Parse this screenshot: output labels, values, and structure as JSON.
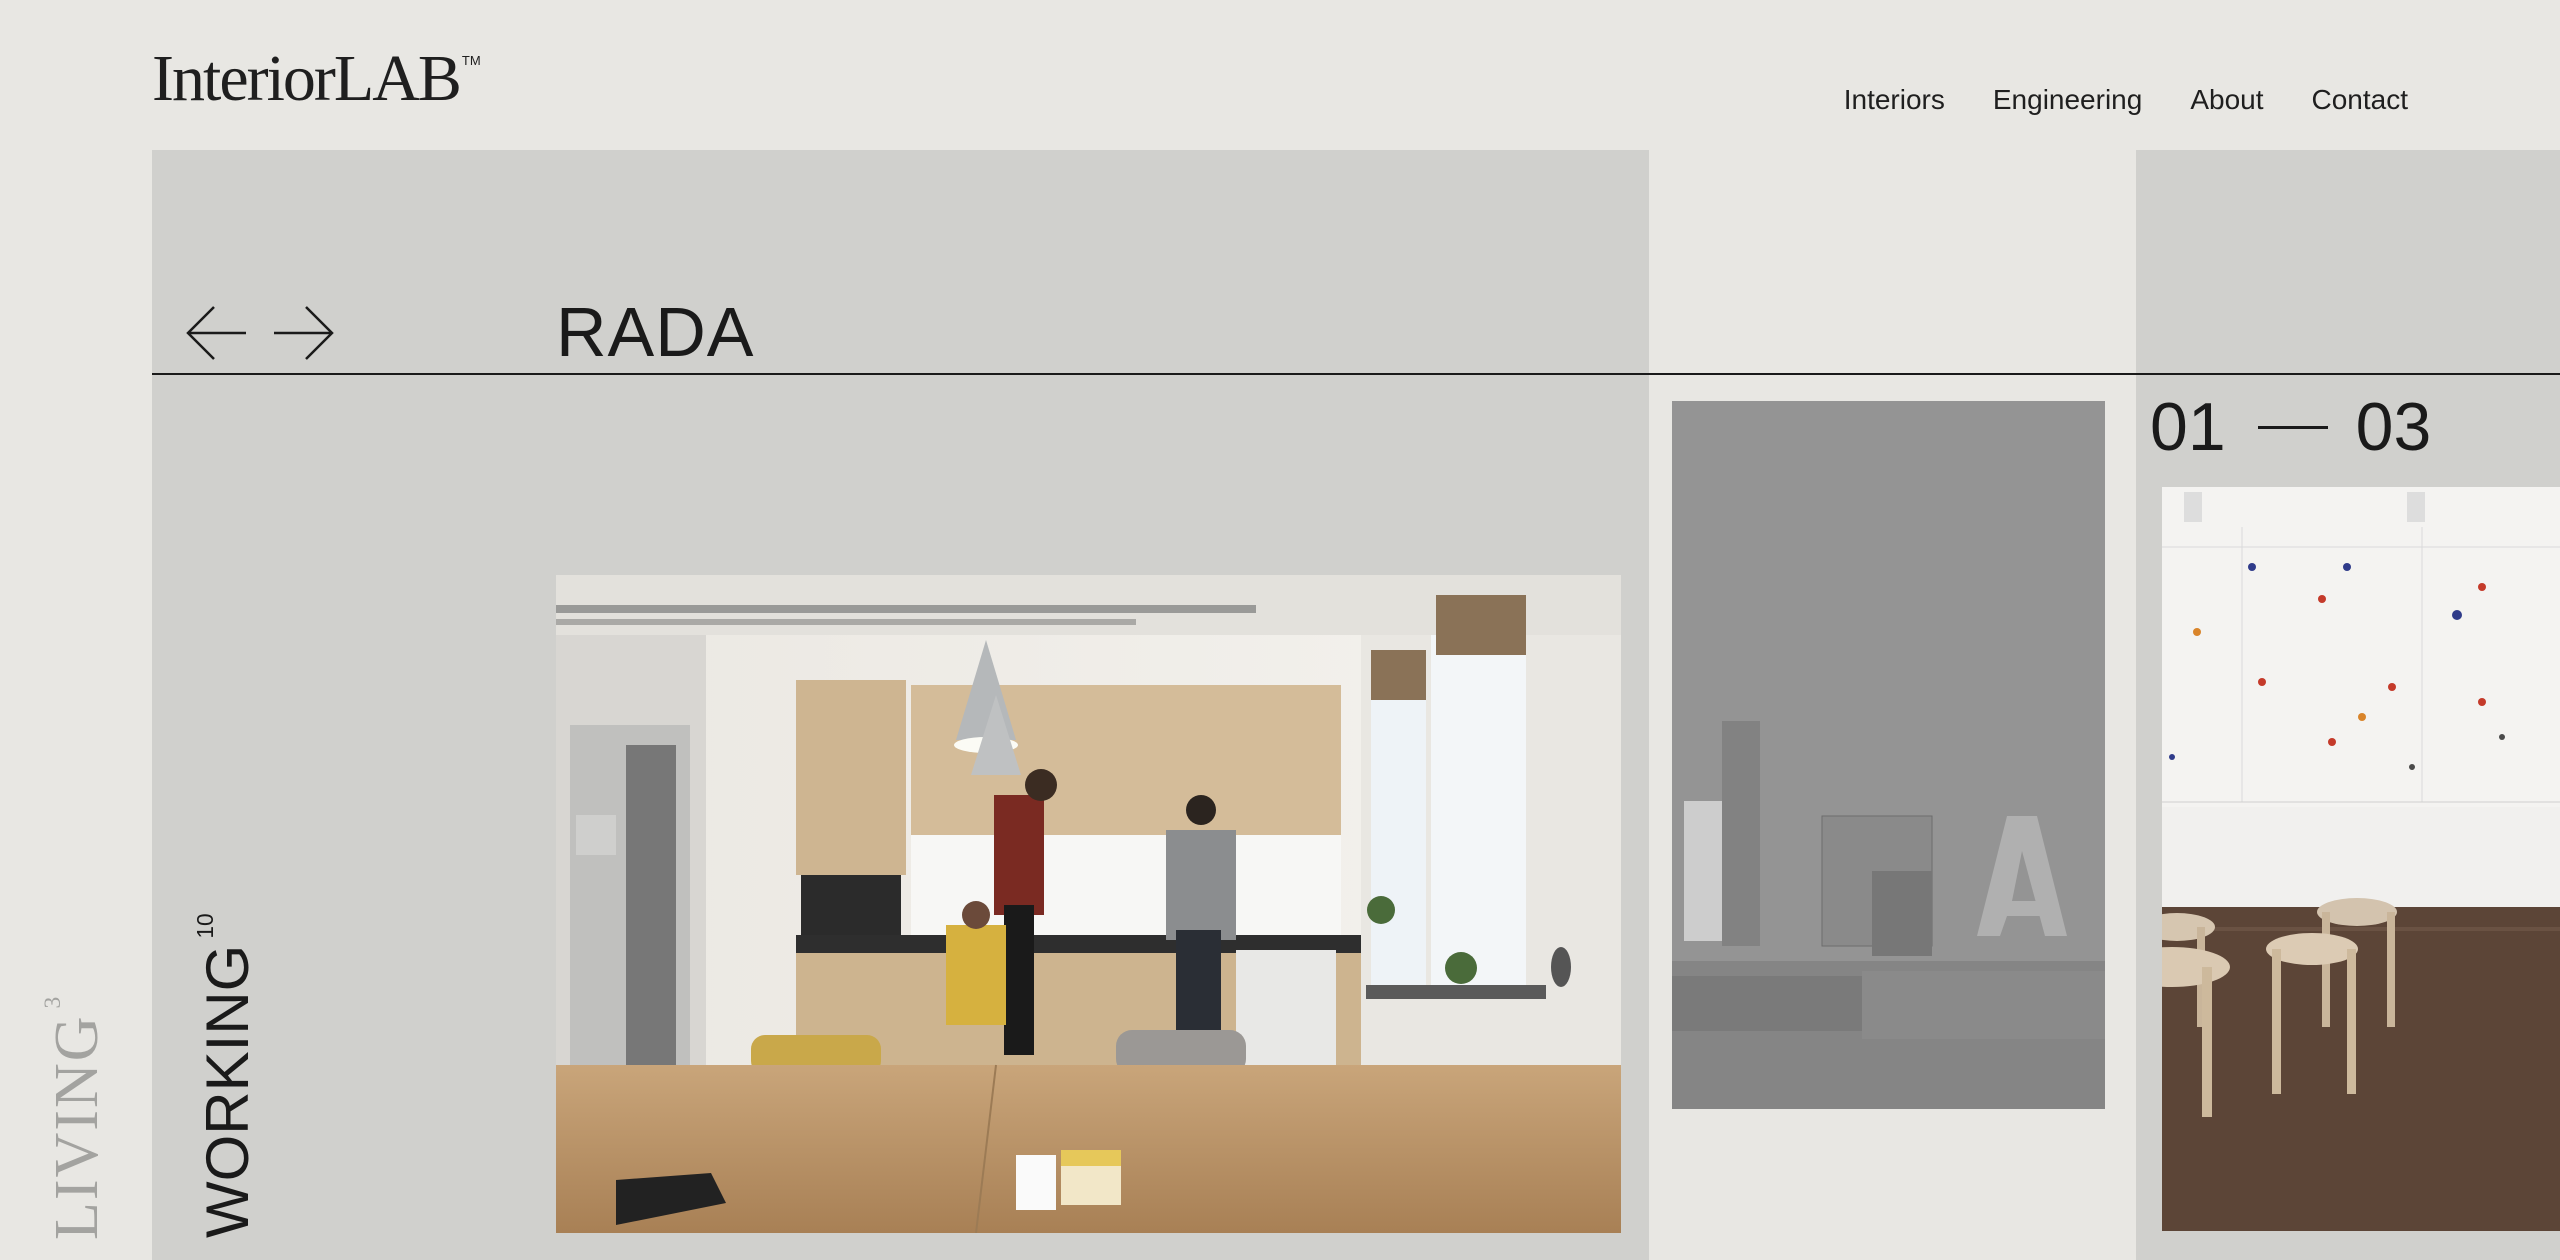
{
  "header": {
    "logo_text": "InteriorLAB",
    "logo_tm": "TM",
    "nav": [
      {
        "label": "Interiors"
      },
      {
        "label": "Engineering"
      },
      {
        "label": "About"
      },
      {
        "label": "Contact"
      }
    ]
  },
  "project": {
    "title": "RADA",
    "counter_current": "01",
    "counter_total": "03"
  },
  "categories": {
    "working": {
      "label": "WORKING",
      "count": "10"
    },
    "living": {
      "label": "LIVING",
      "count": "3"
    }
  },
  "images": [
    {
      "name": "kitchen-office-photo",
      "alt": "RADA kitchen"
    },
    {
      "name": "concrete-logo-photo",
      "alt": "RADA sign"
    },
    {
      "name": "studio-stools-photo",
      "alt": "RADA studio"
    }
  ],
  "colors": {
    "background": "#e8e7e3",
    "panel": "#d0d0cd",
    "text": "#1a1a1a",
    "muted": "#a3a3a0"
  }
}
